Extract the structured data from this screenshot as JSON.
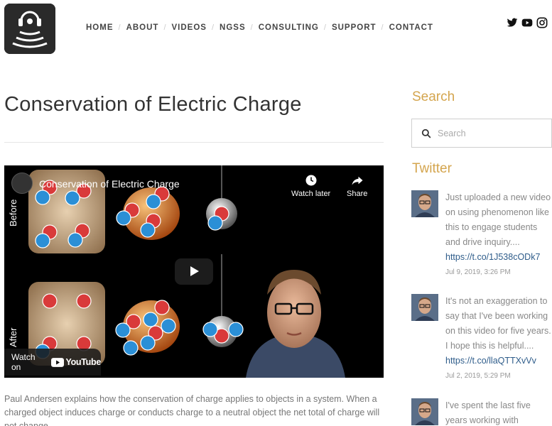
{
  "nav": {
    "items": [
      "HOME",
      "ABOUT",
      "VIDEOS",
      "NGSS",
      "CONSULTING",
      "SUPPORT",
      "CONTACT"
    ]
  },
  "social": {
    "icons": [
      "twitter-icon",
      "youtube-icon",
      "instagram-icon"
    ]
  },
  "page": {
    "title": "Conservation of Electric Charge",
    "description": "Paul Andersen explains how the conservation of charge applies to objects in a system. When a charged object induces charge or conducts charge to a neutral object the net total of charge will not change."
  },
  "video": {
    "title": "Conservation of Electric Charge",
    "watch_later": "Watch later",
    "share": "Share",
    "watch_on": "Watch on",
    "youtube": "YouTube",
    "label_before": "Before",
    "label_after": "After"
  },
  "sidebar": {
    "search_heading": "Search",
    "search_placeholder": "Search",
    "twitter_heading": "Twitter",
    "tweets": [
      {
        "text": "Just uploaded a new video on using phenomenon like this to engage students and drive inquiry....",
        "link": "https://t.co/1J538cODk7",
        "date": "Jul 9, 2019, 3:26 PM"
      },
      {
        "text": "It's not an exaggeration to say that I've been working on this video for five years. I hope this is helpful....",
        "link": "https://t.co/llaQTTXvVv",
        "date": "Jul 2, 2019, 5:29 PM"
      },
      {
        "text": "I've spent the last five years working with",
        "link": "",
        "date": ""
      }
    ]
  },
  "colors": {
    "accent": "#d4a54e",
    "link": "#2e5c8a",
    "negative_charge": "#2b8fd6",
    "positive_charge": "#d93a3a"
  }
}
